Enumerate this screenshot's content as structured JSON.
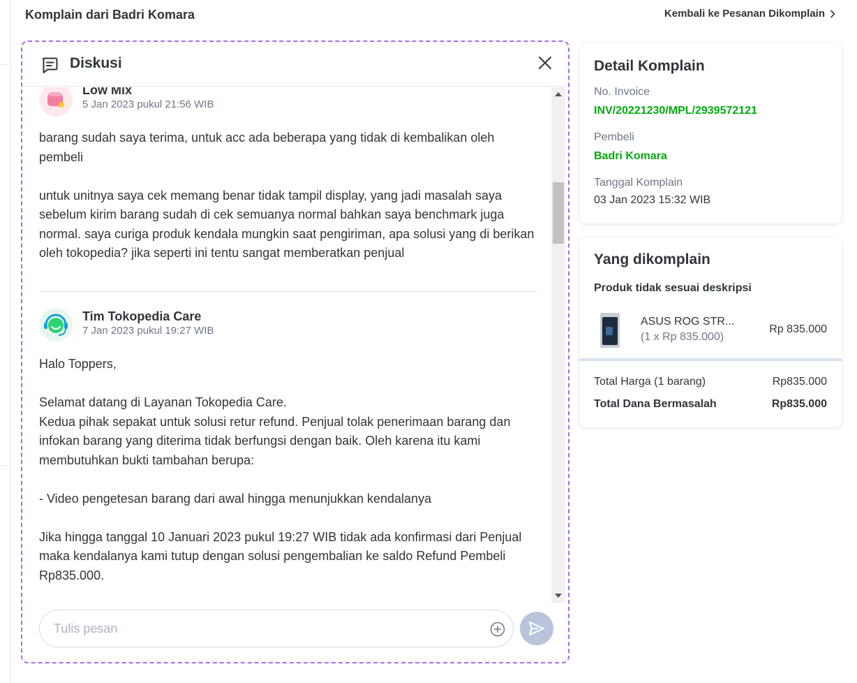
{
  "header": {
    "title": "Komplain dari Badri Komara",
    "back_link": "Kembali ke Pesanan Dikomplain"
  },
  "discussion": {
    "title": "Diskusi",
    "messages": [
      {
        "sender": "Low Mix",
        "time": "5 Jan 2023 pukul 21:56 WIB",
        "body": "barang sudah saya terima, untuk acc ada beberapa yang tidak di kembalikan oleh pembeli\n\nuntuk unitnya saya cek memang benar tidak tampil display, yang jadi masalah saya sebelum kirim barang sudah di cek semuanya normal bahkan saya benchmark juga normal. saya curiga produk kendala mungkin saat pengiriman, apa solusi yang di berikan oleh tokopedia? jika seperti ini tentu sangat memberatkan penjual"
      },
      {
        "sender": "Tim Tokopedia Care",
        "time": "7 Jan 2023 pukul 19:27 WIB",
        "body": "Halo Toppers,\n\nSelamat datang di Layanan Tokopedia Care.\nKedua pihak sepakat untuk solusi retur refund. Penjual tolak penerimaan barang dan infokan barang yang diterima tidak berfungsi dengan baik. Oleh karena itu kami membutuhkan bukti tambahan berupa:\n\n- Video pengetesan barang dari awal hingga menunjukkan kendalanya\n\nJika hingga tanggal 10 Januari 2023 pukul 19:27 WIB tidak ada konfirmasi dari Penjual maka kendalanya kami tutup dengan solusi pengembalian ke saldo Refund Pembeli Rp835.000."
      }
    ],
    "composer": {
      "placeholder": "Tulis pesan"
    }
  },
  "detail": {
    "title": "Detail Komplain",
    "invoice_label": "No. Invoice",
    "invoice_value": "INV/20221230/MPL/2939572121",
    "buyer_label": "Pembeli",
    "buyer_value": "Badri Komara",
    "date_label": "Tanggal Komplain",
    "date_value": "03 Jan 2023 15:32 WIB"
  },
  "complained": {
    "title": "Yang dikomplain",
    "reason": "Produk tidak sesuai deskripsi",
    "product_name": "ASUS ROG STR...",
    "product_qty": "(1 x Rp 835.000)",
    "product_price": "Rp 835.000",
    "total_price_label": "Total Harga (1 barang)",
    "total_price_value": "Rp835.000",
    "total_problem_label": "Total Dana Bermasalah",
    "total_problem_value": "Rp835.000"
  },
  "colors": {
    "accent_green": "#03ac0e",
    "focus_border": "#a66de8",
    "send_button": "#b8c4dc"
  },
  "icons": [
    "chevron-right-icon",
    "chat-icon",
    "close-icon",
    "add-circle-icon",
    "send-icon"
  ]
}
